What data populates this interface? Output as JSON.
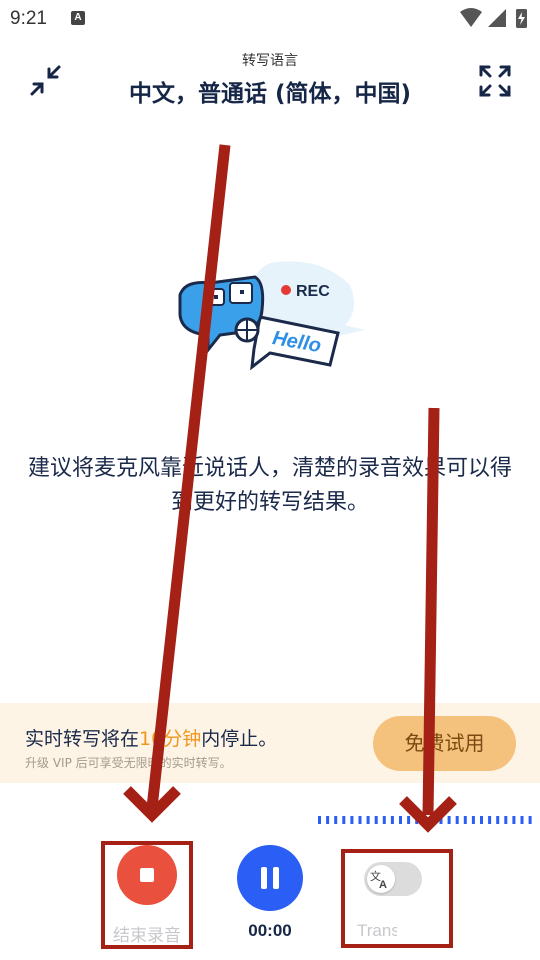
{
  "status_bar": {
    "time": "9:21",
    "notification_icon_letter": "A",
    "icons": [
      "wifi-icon",
      "signal-icon",
      "battery-charging-icon"
    ]
  },
  "header": {
    "label": "转写语言",
    "language": "中文，普通话 (简体，中国)",
    "left_icon": "collapse-icon",
    "right_icon": "fullscreen-icon"
  },
  "illustration": {
    "rec_text": "REC",
    "bubble_text": "Hello",
    "icon": "microphone-globe-icon"
  },
  "tip": "建议将麦克风靠近说话人，清楚的录音效果可以得到更好的转写结果。",
  "banner": {
    "prefix": "实时转写将在",
    "highlight": "10分钟",
    "suffix": "内停止。",
    "sub": "升级 VIP 后可享受无限时的实时转写。",
    "trial_button": "免费试用"
  },
  "controls": {
    "stop_label": "结束录音",
    "timer": "00:00",
    "translate_label": "Trans",
    "translate_enabled": false,
    "stop_color": "#e9503e",
    "pause_color": "#2b5ef5"
  },
  "annotation_color": "#a52015"
}
